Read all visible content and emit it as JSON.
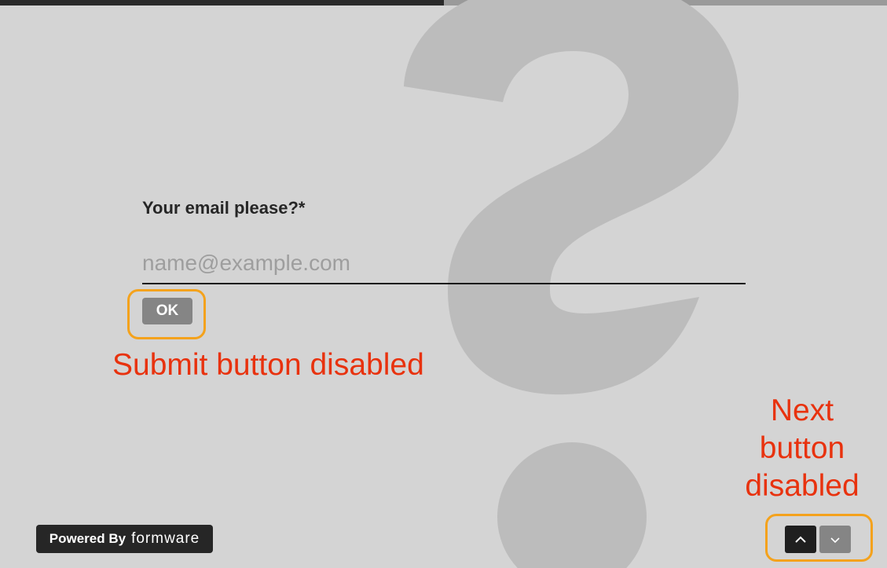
{
  "progress": {
    "fraction": 0.5
  },
  "question": {
    "label": "Your email please?*",
    "placeholder": "name@example.com",
    "value": ""
  },
  "submit_button": {
    "label": "OK",
    "state": "disabled"
  },
  "branding": {
    "prefix": "Powered By",
    "brand": "formware"
  },
  "navigation": {
    "prev_icon": "chevron-up-icon",
    "next_icon": "chevron-down-icon",
    "next_state": "disabled"
  },
  "annotations": {
    "submit_note": "Submit button disabled",
    "next_note_lines": [
      "Next",
      "button",
      "disabled"
    ]
  },
  "colors": {
    "background": "#d4d4d4",
    "question_mark": "#bcbcbc",
    "progress_filled": "#2a2a2a",
    "progress_track": "#9a9a9a",
    "button_disabled": "#858585",
    "nav_active": "#1f1f1f",
    "annotation_text": "#e8320e",
    "annotation_outline": "#f4a21c"
  }
}
